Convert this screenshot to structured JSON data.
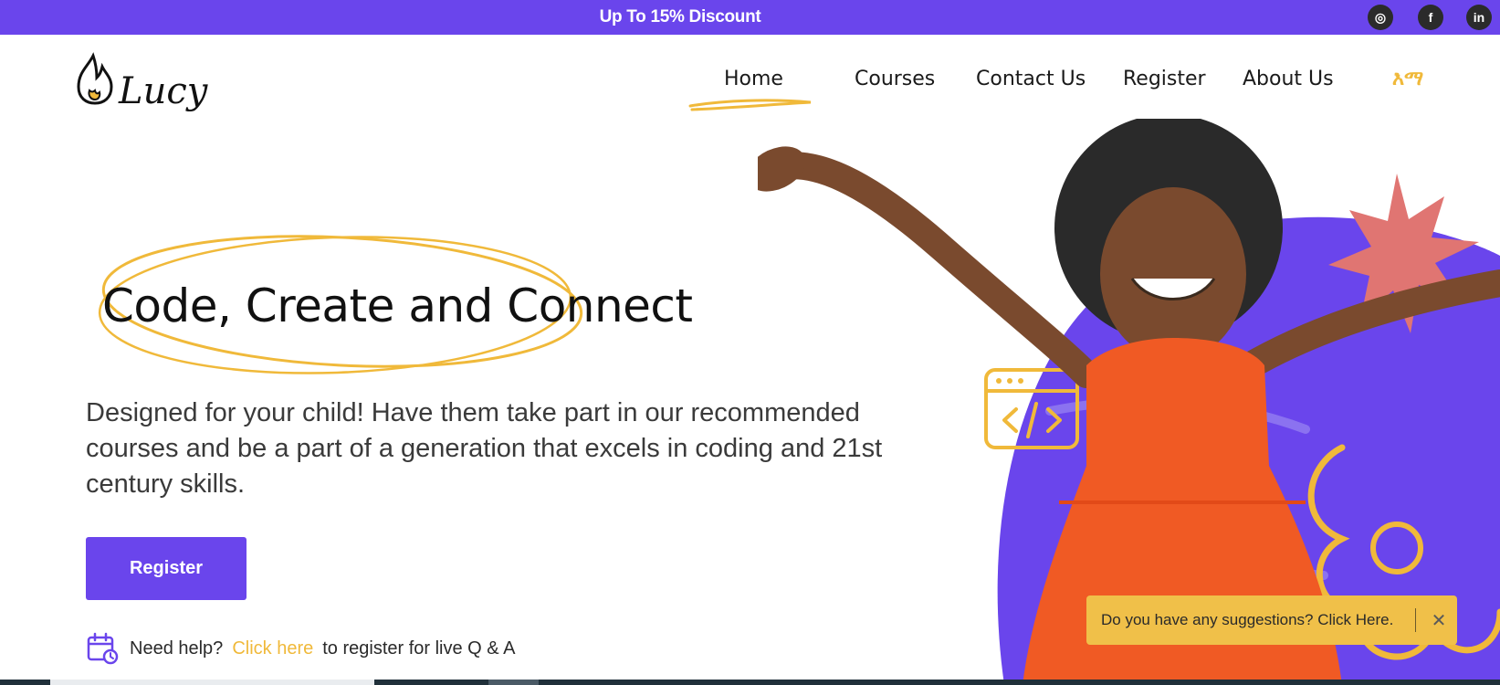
{
  "topbar": {
    "promo_text": "Up To 15% Discount",
    "social": {
      "instagram": "◎",
      "facebook": "f",
      "linkedin": "in"
    }
  },
  "brand": {
    "logo_text": "Lucy"
  },
  "nav": {
    "items": [
      {
        "label": "Home",
        "active": true
      },
      {
        "label": "Courses"
      },
      {
        "label": "Contact Us"
      },
      {
        "label": "Register"
      },
      {
        "label": "About Us"
      }
    ],
    "language": "እማ"
  },
  "hero": {
    "title": "Code, Create and Connect",
    "description": "Designed for your child! Have them take part in our recommended courses and be a part of a generation that excels in coding and 21st century skills.",
    "register_label": "Register"
  },
  "help": {
    "prefix": "Need help?",
    "link": "Click here",
    "suffix": "to register for live Q & A"
  },
  "toast": {
    "text": "Do you have any suggestions? Click Here.",
    "close": "✕"
  },
  "colors": {
    "primary": "#6a45ec",
    "accent": "#f0b93a",
    "toast": "#f0c049",
    "star": "#e07572",
    "dress": "#f05a24"
  }
}
